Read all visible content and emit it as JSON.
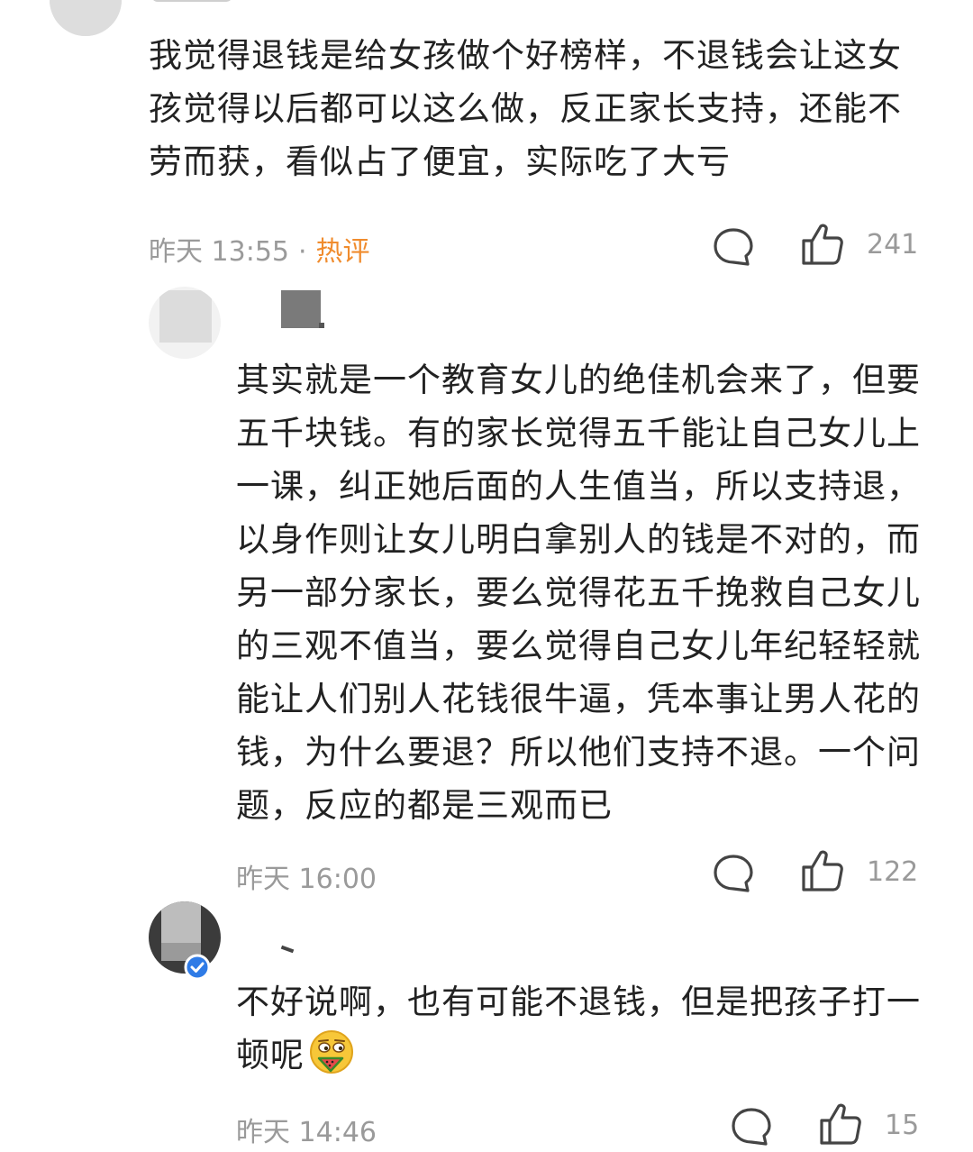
{
  "comments": [
    {
      "text": "我觉得退钱是给女孩做个好榜样，不退钱会让这女孩觉得以后都可以这么做，反正家长支持，还能不劳而获，看似占了便宜，实际吃了大亏",
      "time": "昨天 13:55",
      "separator": "·",
      "tag": "热评",
      "likes": "241"
    },
    {
      "text": "其实就是一个教育女儿的绝佳机会来了，但要五千块钱。有的家长觉得五千能让自己女儿上一课，纠正她后面的人生值当，所以支持退，以身作则让女儿明白拿别人的钱是不对的，而另一部分家长，要么觉得花五千挽救自己女儿的三观不值当，要么觉得自己女儿年纪轻轻就能让人们别人花钱很牛逼，凭本事让男人花的钱，为什么要退？所以他们支持不退。一个问题，反应的都是三观而已",
      "time": "昨天 16:00",
      "likes": "122"
    },
    {
      "text": "不好说啊，也有可能不退钱，但是把孩子打一顿呢",
      "emoji": "smirk-watermelon-emoji",
      "time": "昨天 14:46",
      "likes": "15"
    }
  ],
  "icons": {
    "reply": "comment-bubble-icon",
    "like": "thumbs-up-icon",
    "verified": "verified-badge-icon"
  },
  "colors": {
    "text": "#222222",
    "meta": "#9a9a9a",
    "hot_tag": "#f08c2e",
    "verified": "#2f7be6"
  }
}
